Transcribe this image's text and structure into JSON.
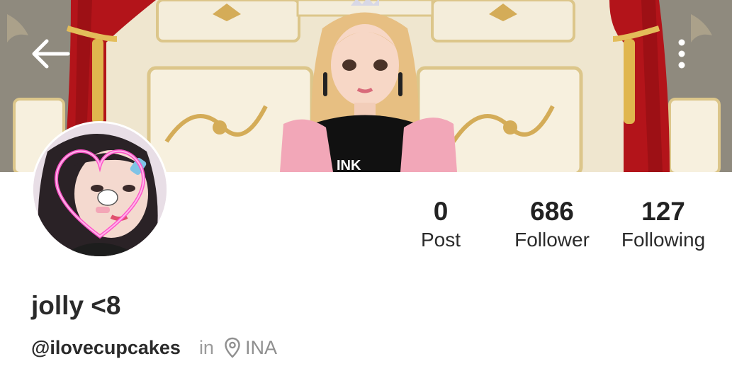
{
  "header": {
    "back_icon": "arrow-left-icon",
    "more_icon": "vertical-dots-icon"
  },
  "profile": {
    "display_name": "jolly <8",
    "username": "@ilovecupcakes",
    "in_label": "in",
    "location_icon": "map-pin-icon",
    "location": "INA"
  },
  "stats": {
    "post": {
      "count": "0",
      "label": "Post"
    },
    "follower": {
      "count": "686",
      "label": "Follower"
    },
    "following": {
      "count": "127",
      "label": "Following"
    }
  },
  "colors": {
    "curtain": "#b3141a",
    "gold": "#d9b35a",
    "cream": "#f2ead6",
    "heart_neon": "#ff4fc8",
    "text_primary": "#2a2a2a",
    "text_muted": "#9b9b9b"
  }
}
